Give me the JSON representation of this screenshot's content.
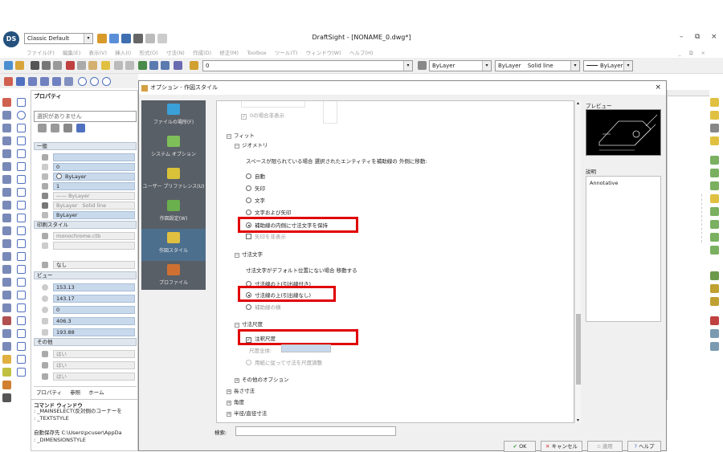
{
  "window": {
    "title": "DraftSight - [NONAME_0.dwg*]",
    "minimize": "–",
    "maximize": "⧉",
    "close": "×",
    "mdi_min": "_",
    "mdi_restore": "⧉",
    "mdi_close": "×"
  },
  "app_logo": "DS",
  "workspace": "Classic Default",
  "menu": [
    "ファイル(F)",
    "編集(E)",
    "表示(V)",
    "挿入(I)",
    "形式(O)",
    "寸法(N)",
    "作成(D)",
    "修正(M)",
    "Toolbox",
    "ツール(T)",
    "ウィンドウ(W)",
    "ヘルプ(H)"
  ],
  "toolbar": {
    "layer_value": "0",
    "color_value": "ByLayer",
    "linestyle_value": "ByLayer",
    "linestyle_type": "Solid line",
    "lineweight_value": "ByLayer"
  },
  "properties_panel": {
    "title": "プロパティ",
    "selection": "選択がありません",
    "section_general": "一般",
    "layer": "0",
    "color": "ByLayer",
    "linestyle_scale": "1",
    "lineweight": "ByLayer",
    "linestyle": "Solid line",
    "linestyle_prefix": "ByLayer",
    "transparency": "ByLayer",
    "section_print_style": "印刷スタイル",
    "print_table": "monochrome.ctb",
    "print_none": "なし",
    "section_view": "ビュー",
    "view_values": [
      "153.13",
      "143.17",
      "0",
      "406.3",
      "193.88"
    ],
    "section_other": "その他",
    "other_values": [
      "はい",
      "はい",
      "はい"
    ],
    "bottom_tabs": [
      "プロパティ",
      "参照",
      "ホーム"
    ]
  },
  "command_window": {
    "title": "コマンド ウィンドウ",
    "lines": [
      ": _MAINSELECT(反対側のコーナーを",
      ": _TEXTSTYLE",
      "",
      "自動保存先 C:\\Users\\pcuser\\AppDa",
      ": _DIMENSIONSTYLE"
    ]
  },
  "dialog": {
    "title": "オプション - 作図スタイル",
    "close": "×",
    "nav": [
      {
        "label": "ファイルの場所(F)",
        "color": "#3aa0d8"
      },
      {
        "label": "システム オプション",
        "color": "#7fbf5a"
      },
      {
        "label": "ユーザー プリファレンス(U)",
        "color": "#d8c23a"
      },
      {
        "label": "作図設定(W)",
        "color": "#6ab04c"
      },
      {
        "label": "作図スタイル",
        "color": "#e0c040"
      },
      {
        "label": "プロファイル",
        "color": "#d07030"
      }
    ],
    "top_check": "0の場合非表示",
    "tree": {
      "fit": "フィット",
      "placement": "ジオメトリ",
      "placement_desc": "スペースが限られている場合 選択されたエンティティを補助線の 外側に移動:",
      "radio_options": [
        "自動",
        "矢印",
        "文字",
        "文字および矢印"
      ],
      "keep_inside": "補助線の内側に寸法文字を保持",
      "suppress_arrows": "矢印を非表示",
      "dim_text": "寸法文字",
      "dim_text_desc": "寸法文字がデフォルト位置にない場合 移動する",
      "text_opts": [
        "寸法線の上(引出線付き)",
        "寸法線の上(引出線なし)",
        "補助線の横"
      ],
      "dim_scale": "寸法尺度",
      "annotative": "注釈尺度",
      "overall_scale": "尺度全体:",
      "scale_to_layout": "用紙に従って寸法を尺度調整",
      "other_options": "その他のオプション",
      "length_dims": "長さ寸法",
      "angle": "角度",
      "radius_diameter": "半径/直径寸法"
    },
    "preview_label": "プレビュー",
    "description_label": "説明",
    "description_value": "Annotative",
    "search_label": "検索:",
    "buttons": {
      "ok": "OK",
      "cancel": "キャンセル",
      "apply": "適用",
      "help": "ヘルプ"
    }
  }
}
